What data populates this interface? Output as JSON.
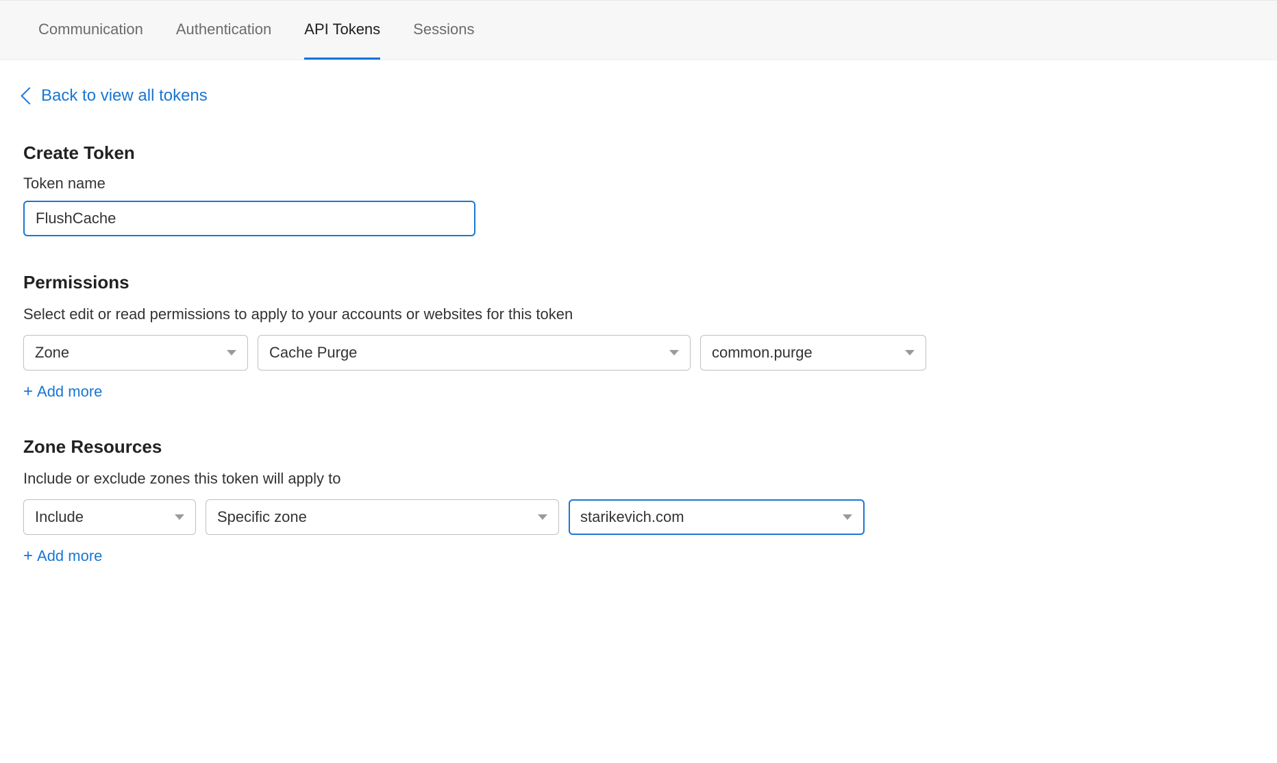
{
  "tabs": {
    "items": [
      {
        "label": "Communication",
        "active": false
      },
      {
        "label": "Authentication",
        "active": false
      },
      {
        "label": "API Tokens",
        "active": true
      },
      {
        "label": "Sessions",
        "active": false
      }
    ]
  },
  "back_link": {
    "label": "Back to view all tokens"
  },
  "create_token": {
    "title": "Create Token",
    "token_name_label": "Token name",
    "token_name_value": "FlushCache"
  },
  "permissions": {
    "title": "Permissions",
    "subtitle": "Select edit or read permissions to apply to your accounts or websites for this token",
    "row": {
      "scope": "Zone",
      "permission": "Cache Purge",
      "action": "common.purge"
    },
    "add_more": "Add more"
  },
  "zone_resources": {
    "title": "Zone Resources",
    "subtitle": "Include or exclude zones this token will apply to",
    "row": {
      "mode": "Include",
      "scope": "Specific zone",
      "zone": "starikevich.com"
    },
    "add_more": "Add more"
  }
}
